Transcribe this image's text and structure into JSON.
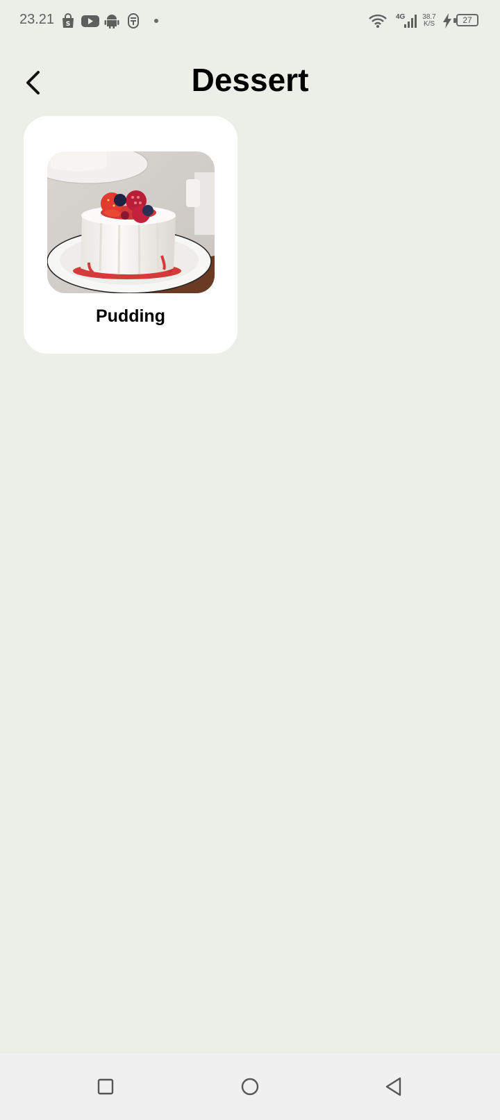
{
  "status_bar": {
    "time": "23.21",
    "network_type": "4G",
    "net_speed_value": "38.7",
    "net_speed_unit": "K/S",
    "battery": "27",
    "icons": [
      "shopping-bag-icon",
      "youtube-icon",
      "android-icon",
      "app-icon",
      "dot-icon",
      "wifi-icon",
      "signal-icon",
      "charging-icon",
      "battery-icon"
    ]
  },
  "header": {
    "title": "Dessert",
    "back_icon": "back-arrow-icon"
  },
  "items": [
    {
      "label": "Pudding",
      "image": "panna-cotta-with-berries"
    }
  ],
  "nav_bar": {
    "buttons": [
      "recent-apps-icon",
      "home-icon",
      "back-icon"
    ]
  }
}
